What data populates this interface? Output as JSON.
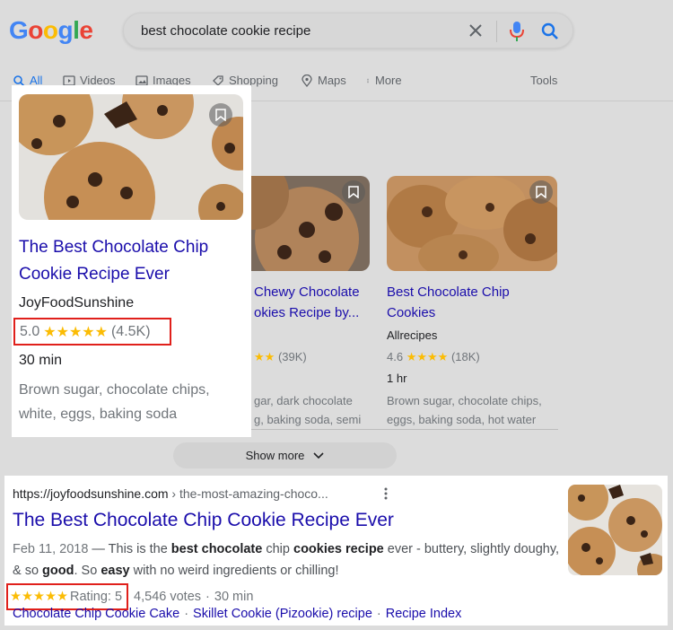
{
  "search": {
    "logo": [
      "G",
      "o",
      "o",
      "g",
      "l",
      "e"
    ],
    "logo_colors": [
      "#4285f4",
      "#ea4335",
      "#fbbc05",
      "#4285f4",
      "#34a853",
      "#ea4335"
    ],
    "query": "best chocolate cookie recipe"
  },
  "tabs": [
    {
      "label": "All",
      "icon": "search-icon",
      "active": true
    },
    {
      "label": "Videos",
      "icon": "video-icon"
    },
    {
      "label": "Images",
      "icon": "image-icon"
    },
    {
      "label": "Shopping",
      "icon": "tag-icon"
    },
    {
      "label": "Maps",
      "icon": "map-pin-icon"
    },
    {
      "label": "More",
      "icon": "kebab-icon"
    },
    {
      "label": "Tools"
    }
  ],
  "featured_card": {
    "title": "The Best Chocolate Chip Cookie Recipe Ever",
    "source": "JoyFoodSunshine",
    "rating": "5.0",
    "stars": "★★★★★",
    "reviews": "(4.5K)",
    "time": "30 min",
    "ingredients": "Brown sugar, chocolate chips, white, eggs, baking soda"
  },
  "cards": [
    {
      "title_line1": "Chewy Chocolate",
      "title_line2": "okies Recipe by...",
      "rating_stars": "★★",
      "reviews": "(39K)",
      "ingredients_line1": "gar, dark chocolate",
      "ingredients_line2": "g, baking soda, semi"
    },
    {
      "title_line1": "Best Chocolate Chip",
      "title_line2": "Cookies",
      "source": "Allrecipes",
      "rating": "4.6",
      "rating_stars": "★★★★",
      "reviews": "(18K)",
      "time": "1 hr",
      "ingredients_line1": "Brown sugar, chocolate chips,",
      "ingredients_line2": "eggs, baking soda, hot water"
    }
  ],
  "show_more": "Show more",
  "result": {
    "url": "https://joyfoodsunshine.com",
    "breadcrumb": " › the-most-amazing-choco...",
    "title": "The Best Chocolate Chip Cookie Recipe Ever",
    "date": "Feb 11, 2018",
    "snippet_parts": [
      " — This is the ",
      "best chocolate",
      " chip ",
      "cookies recipe",
      " ever - buttery, slightly doughy, & so ",
      "good",
      ". So ",
      "easy",
      " with no weird ingredients or chilling!"
    ],
    "stars": "★★★★★",
    "rating_label": "Rating: 5",
    "votes": "4,546 votes",
    "time": "30 min",
    "links": [
      "Chocolate Chip Cookie Cake",
      "Skillet Cookie (Pizookie) recipe",
      "Recipe Index"
    ]
  }
}
